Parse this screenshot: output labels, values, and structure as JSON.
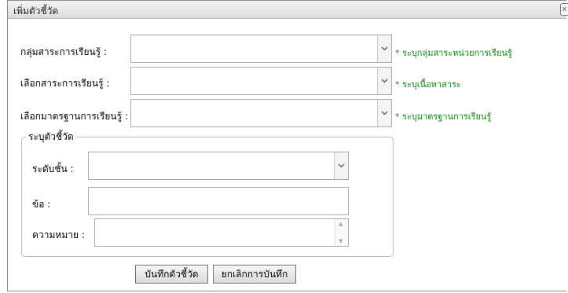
{
  "dialog": {
    "title": "เพิ่มตัวชี้วัด",
    "close_label": "x"
  },
  "rows": [
    {
      "label": "กลุ่มสาระการเรียนรู้ :",
      "value": "",
      "hint": "* ระบุกลุ่มสาระหน่วยการเรียนรู้"
    },
    {
      "label": "เลือกสาระการเรียนรู้ :",
      "value": "",
      "hint": "* ระบุเนื้อหาสาระ"
    },
    {
      "label": "เลือกมาตรฐานการเรียนรู้ :",
      "value": "",
      "hint": "* ระบุมาตรฐานการเรียนรู้"
    }
  ],
  "indicator_group": {
    "legend": "ระบุตัวชี้วัด",
    "level_label": "ระดับชั้น :",
    "level_value": "",
    "item_label": "ข้อ :",
    "item_value": "",
    "meaning_label": "ความหมาย :",
    "meaning_value": ""
  },
  "buttons": {
    "save": "บันทึกตัวชี้วัด",
    "cancel": "ยกเลิกการบันทึก"
  },
  "colors": {
    "hint": "#0a8a0a",
    "border": "#a9a9a9"
  }
}
